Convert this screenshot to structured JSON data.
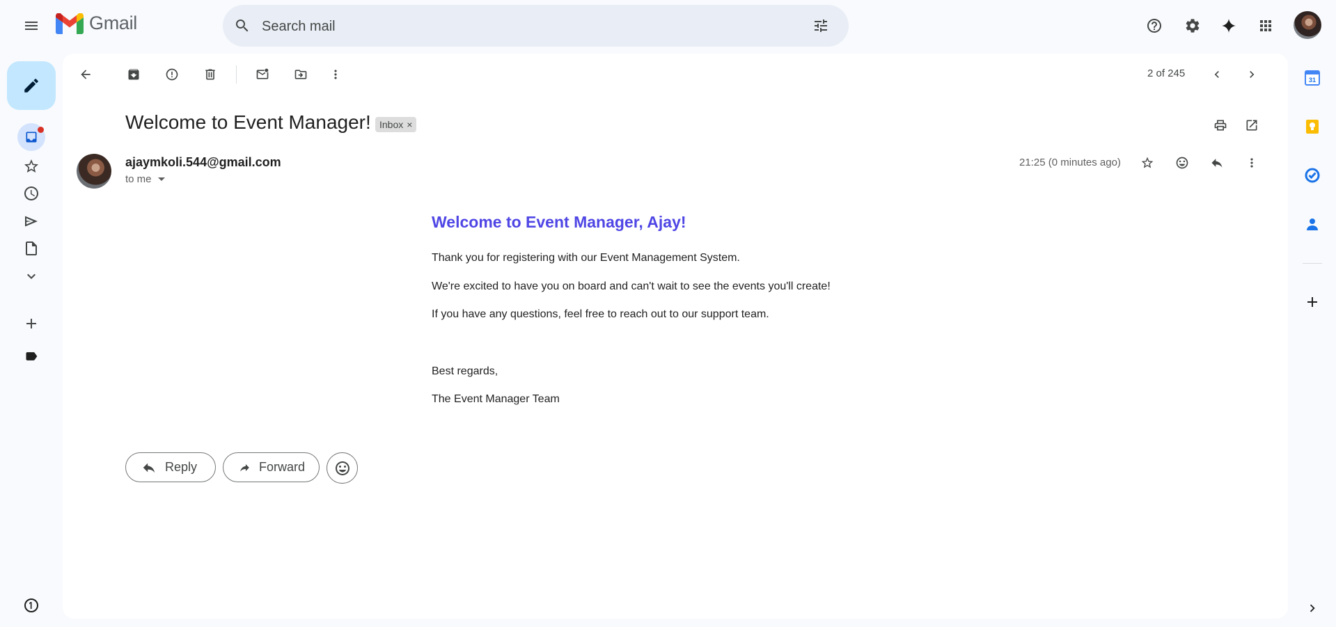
{
  "app": {
    "name": "Gmail"
  },
  "search": {
    "placeholder": "Search mail"
  },
  "toolbar": {
    "counter": "2 of 245"
  },
  "email": {
    "subject": "Welcome to Event Manager!",
    "label_chip": "Inbox",
    "label_chip_remove": "×",
    "sender": "ajaymkoli.544@gmail.com",
    "recipient": "to me",
    "time": "21:25 (0 minutes ago)",
    "body": {
      "heading": "Welcome to Event Manager, Ajay!",
      "line1": "Thank you for registering with our Event Management System.",
      "line2": "We're excited to have you on board and can't wait to see the events you'll create!",
      "line3": "If you have any questions, feel free to reach out to our support team.",
      "signoff": "Best regards,",
      "signature": "The Event Manager Team"
    }
  },
  "actions": {
    "reply": "Reply",
    "forward": "Forward"
  },
  "colors": {
    "accent_heading": "#4f46e5",
    "compose_bg": "#c2e7ff",
    "search_bg": "#e9eef6",
    "unread_dot": "#d93025"
  },
  "calendar_day": "31"
}
